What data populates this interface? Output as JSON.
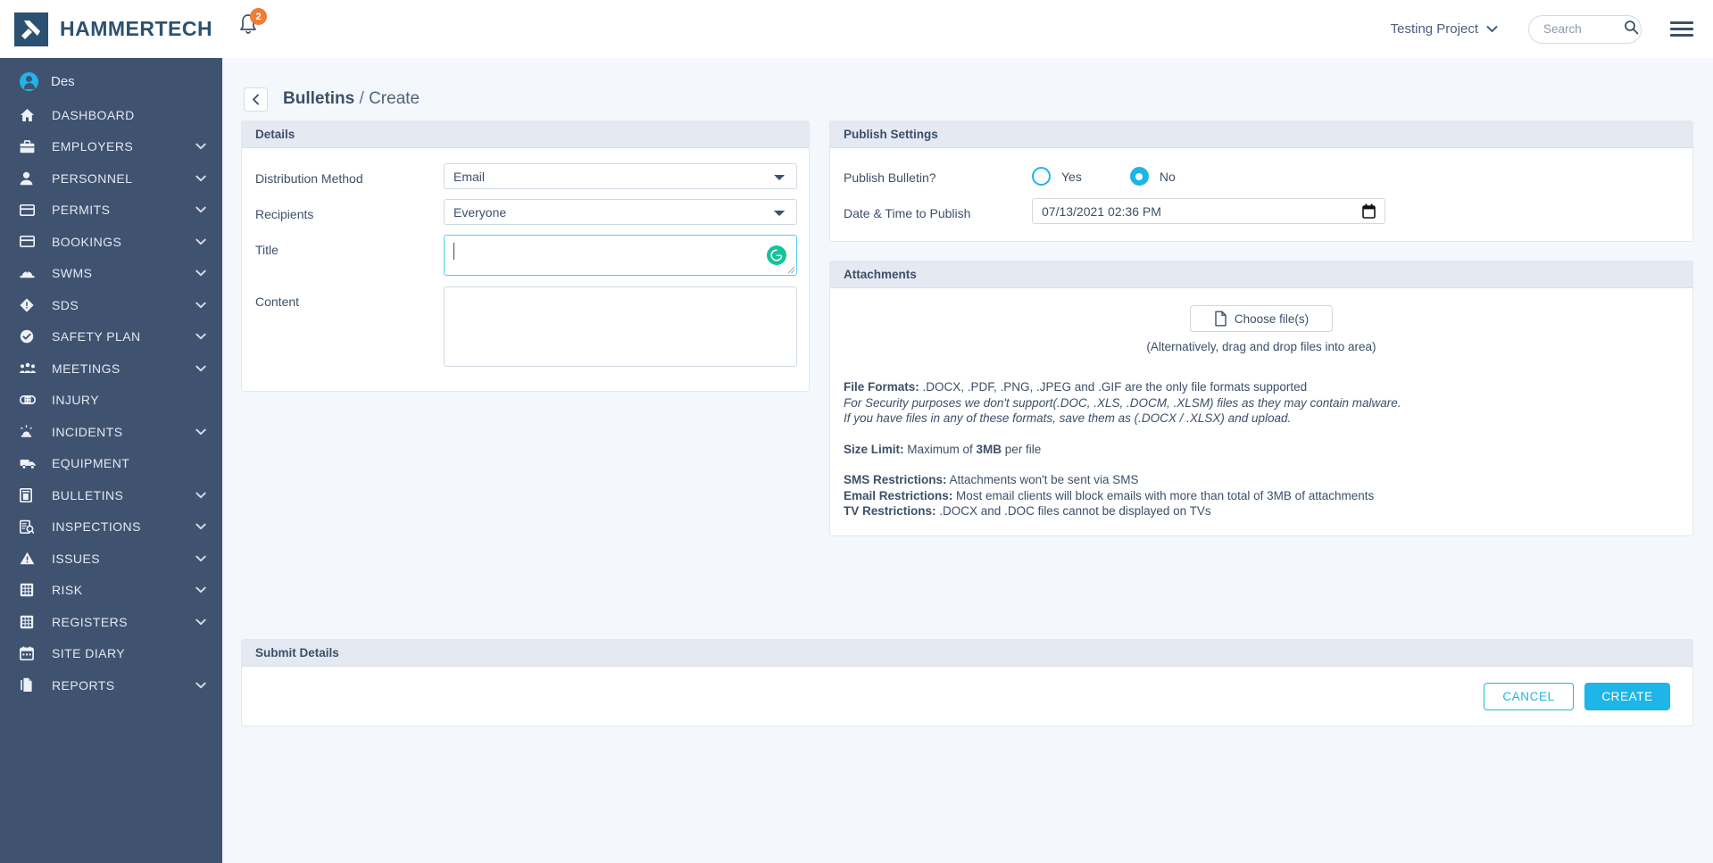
{
  "brand": {
    "name": "HAMMERTECH",
    "logo_icon": "hammer-logo-icon",
    "primary_color": "#1eb5e8",
    "sidebar_color": "#3f5371",
    "navy": "#2c5170"
  },
  "topbar": {
    "notifications_icon": "bell-icon",
    "notifications_count": "2",
    "project_label": "Testing Project",
    "project_chevron_icon": "chevron-down-icon",
    "search_placeholder": "Search",
    "search_value": "",
    "search_icon": "search-icon",
    "menu_icon": "hamburger-menu-icon"
  },
  "sidebar": {
    "user": {
      "name": "Des",
      "avatar_icon": "user-avatar-icon"
    },
    "items": [
      {
        "label": "DASHBOARD",
        "icon": "home-icon",
        "chevron": false
      },
      {
        "label": "EMPLOYERS",
        "icon": "briefcase-icon",
        "chevron": true
      },
      {
        "label": "PERSONNEL",
        "icon": "person-icon",
        "chevron": true
      },
      {
        "label": "PERMITS",
        "icon": "card-icon",
        "chevron": true
      },
      {
        "label": "BOOKINGS",
        "icon": "card-icon",
        "chevron": true
      },
      {
        "label": "SWMS",
        "icon": "hardhat-icon",
        "chevron": true
      },
      {
        "label": "SDS",
        "icon": "hazard-diamond-icon",
        "chevron": true
      },
      {
        "label": "SAFETY PLAN",
        "icon": "check-circle-icon",
        "chevron": true
      },
      {
        "label": "MEETINGS",
        "icon": "people-group-icon",
        "chevron": true
      },
      {
        "label": "INJURY",
        "icon": "bandage-icon",
        "chevron": false
      },
      {
        "label": "INCIDENTS",
        "icon": "siren-icon",
        "chevron": true
      },
      {
        "label": "EQUIPMENT",
        "icon": "truck-icon",
        "chevron": false
      },
      {
        "label": "BULLETINS",
        "icon": "bulletin-board-icon",
        "chevron": true
      },
      {
        "label": "INSPECTIONS",
        "icon": "clipboard-search-icon",
        "chevron": true
      },
      {
        "label": "ISSUES",
        "icon": "warning-triangle-icon",
        "chevron": true
      },
      {
        "label": "RISK",
        "icon": "grid-matrix-icon",
        "chevron": true
      },
      {
        "label": "REGISTERS",
        "icon": "grid-matrix-icon",
        "chevron": true
      },
      {
        "label": "SITE DIARY",
        "icon": "calendar-icon",
        "chevron": false
      },
      {
        "label": "REPORTS",
        "icon": "documents-icon",
        "chevron": true
      }
    ]
  },
  "page": {
    "back_icon": "chevron-left-icon",
    "breadcrumb_root": "Bulletins",
    "breadcrumb_sep": "/",
    "breadcrumb_leaf": "Create"
  },
  "details": {
    "title": "Details",
    "distribution_method": {
      "label": "Distribution Method",
      "value": "Email",
      "options": [
        "Email"
      ]
    },
    "recipients": {
      "label": "Recipients",
      "value": "Everyone",
      "options": [
        "Everyone"
      ]
    },
    "title_field": {
      "label": "Title",
      "value": "",
      "placeholder": "",
      "assistant_icon": "grammarly-icon",
      "assistant_glyph": "G",
      "assistant_color": "#15c39a"
    },
    "content_field": {
      "label": "Content",
      "value": "",
      "placeholder": ""
    }
  },
  "publish": {
    "title": "Publish Settings",
    "publish_question": "Publish Bulletin?",
    "option_yes": "Yes",
    "option_no": "No",
    "selected": "No",
    "datetime_label": "Date & Time to Publish",
    "datetime_value": "07/13/2021 02:36 PM",
    "calendar_icon": "calendar-icon"
  },
  "attachments": {
    "title": "Attachments",
    "choose_button": "Choose file(s)",
    "file_icon": "file-icon",
    "drag_hint": "(Alternatively, drag and drop files into area)",
    "file_formats_label": "File Formats:",
    "file_formats_text": " .DOCX, .PDF, .PNG, .JPEG and .GIF are the only file formats supported",
    "security_line_1": "For Security purposes we don't support(.DOC, .XLS, .DOCM, .XLSM) files as they may contain malware.",
    "security_line_2": "If you have files in any of these formats, save them as (.DOCX / .XLSX) and upload.",
    "size_limit_label": "Size Limit:",
    "size_limit_pre": " Maximum of ",
    "size_limit_value": "3MB",
    "size_limit_post": " per file",
    "sms_label": "SMS Restrictions:",
    "sms_text": " Attachments won't be sent via SMS",
    "email_label": "Email Restrictions:",
    "email_text": " Most email clients will block emails with more than total of 3MB of attachments",
    "tv_label": "TV Restrictions:",
    "tv_text": " .DOCX and .DOC files cannot be displayed on TVs"
  },
  "submit": {
    "title": "Submit Details",
    "cancel_label": "CANCEL",
    "create_label": "CREATE"
  }
}
